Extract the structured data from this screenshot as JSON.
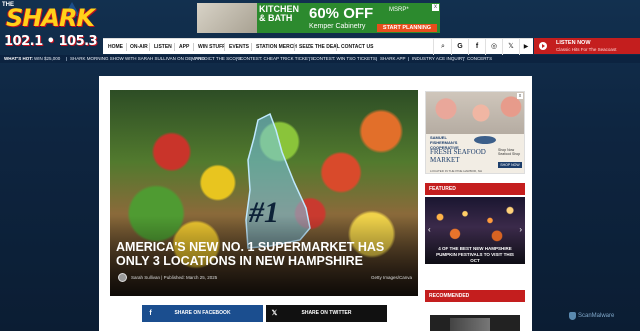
{
  "header": {
    "logo": {
      "the": "THE",
      "name": "SHARK",
      "freq": "102.1 • 105.3"
    },
    "ad": {
      "line1": "KITCHEN",
      "line2": "& BATH",
      "offer": "60% OFF",
      "msrp": "MSRP*",
      "company": "Kemper Cabinetry",
      "cta": "START PLANNING",
      "close": "x"
    },
    "nav": [
      {
        "label": "HOME"
      },
      {
        "label": "ON-AIR"
      },
      {
        "label": "LISTEN"
      },
      {
        "label": "APP"
      },
      {
        "label": "WIN STUFF"
      },
      {
        "label": "EVENTS"
      },
      {
        "label": "STATION MERCH"
      },
      {
        "label": "SEIZE THE DEAL"
      },
      {
        "label": "CONTACT US"
      }
    ],
    "icons": {
      "search": "⌕",
      "google": "G",
      "facebook": "f",
      "instagram": "◎",
      "x": "𝕏",
      "youtube": "▶"
    },
    "listen_now": {
      "title": "LISTEN NOW",
      "subtitle": "Classic Hits For The Seacoast"
    }
  },
  "whats_hot": {
    "label": "WHAT'S HOT:",
    "items": [
      "WIN $25,000",
      "SHARK MORNING SHOW WITH SARAH SULLIVAN ON DEMAND",
      "PREDICT THE SCORE",
      "CONTEST: CHEAP TRICK TICKETS",
      "CONTEST: WIN TSO TICKETS",
      "SHARK APP",
      "INDUSTRY ACE INQUIRY",
      "CONCERTS"
    ]
  },
  "article": {
    "badge": "#1",
    "title": "America's New No. 1 Supermarket Has Only 3 Locations In New Hampshire",
    "byline": "Sarah Sullivan | Published: March 25, 2025",
    "credit": "Getty Images/Canva",
    "share_facebook": "SHARE ON FACEBOOK",
    "share_twitter": "SHARE ON TWITTER"
  },
  "side_ad": {
    "brand": "SAMUEL FISHERMAN'S COOPERATIVE",
    "title": "FRESH SEAFOOD MARKET",
    "shop": "Shop Now Seafood Shop",
    "button": "SHOP NOW",
    "footer": "LOCATED IN THE PINE HARBOR, NH",
    "close": "x"
  },
  "featured": {
    "heading": "FEATURED",
    "card_title": "4 Of The Best New Hampshire Pumpkin Festivals To Visit This Oct",
    "prev": "‹",
    "next": "›"
  },
  "recommended": {
    "heading": "RECOMMENDED"
  },
  "scanmalware": {
    "label": "ScanMalware"
  },
  "colors": {
    "brand_red": "#c41e1e",
    "navy": "#0c2340",
    "facebook": "#1b4e8f"
  }
}
